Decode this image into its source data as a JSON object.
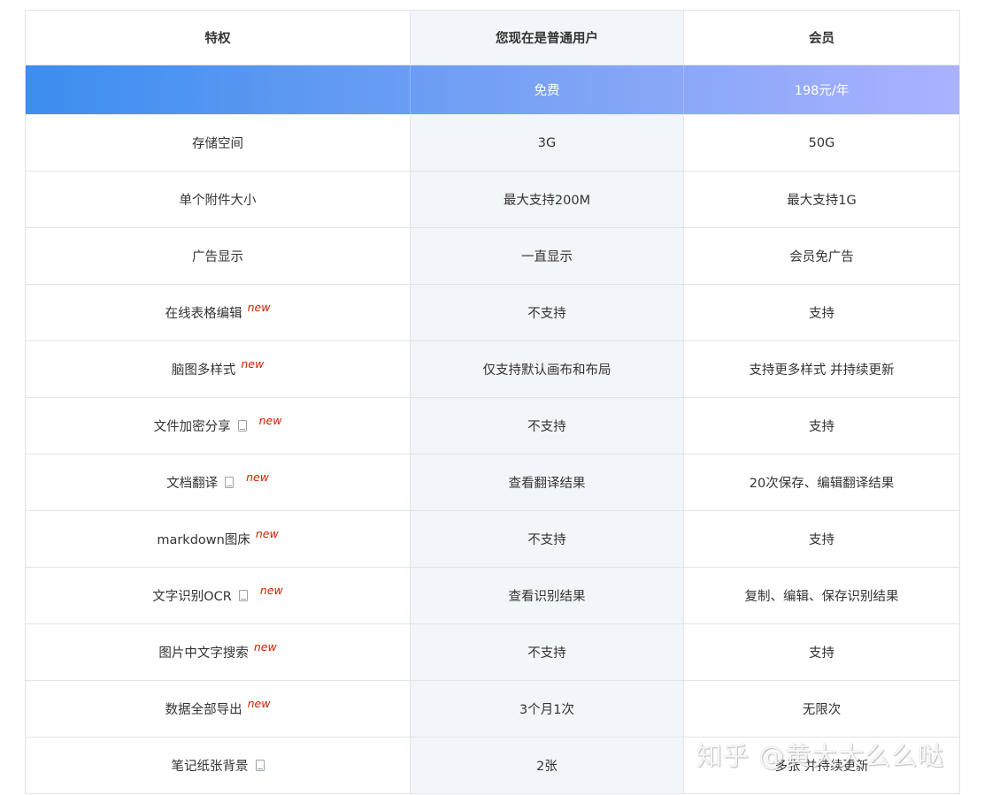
{
  "header": {
    "col1": "特权",
    "col2": "您现在是普通用户",
    "col3": "会员"
  },
  "price": {
    "col1": "",
    "col2": "免费",
    "col3": "198元/年"
  },
  "rows": [
    {
      "feature": "存储空间",
      "device": false,
      "new": "",
      "free": "3G",
      "member": "50G"
    },
    {
      "feature": "单个附件大小",
      "device": false,
      "new": "",
      "free": "最大支持200M",
      "member": "最大支持1G"
    },
    {
      "feature": "广告显示",
      "device": false,
      "new": "",
      "free": "一直显示",
      "member": "会员免广告"
    },
    {
      "feature": "在线表格编辑",
      "device": false,
      "new": "new",
      "free": "不支持",
      "member": "支持"
    },
    {
      "feature": "脑图多样式",
      "device": false,
      "new": "new",
      "free": "仅支持默认画布和布局",
      "member": "支持更多样式 并持续更新"
    },
    {
      "feature": "文件加密分享",
      "device": true,
      "new": "new",
      "free": "不支持",
      "member": "支持"
    },
    {
      "feature": "文档翻译",
      "device": true,
      "new": "new",
      "free": "查看翻译结果",
      "member": "20次保存、编辑翻译结果"
    },
    {
      "feature": "markdown图床",
      "device": false,
      "new": "new",
      "free": "不支持",
      "member": "支持"
    },
    {
      "feature": "文字识别OCR",
      "device": true,
      "new": "new",
      "free": "查看识别结果",
      "member": "复制、编辑、保存识别结果"
    },
    {
      "feature": "图片中文字搜索",
      "device": false,
      "new": "new",
      "free": "不支持",
      "member": "支持"
    },
    {
      "feature": "数据全部导出",
      "device": false,
      "new": "new",
      "free": "3个月1次",
      "member": "无限次"
    },
    {
      "feature": "笔记纸张背景",
      "device": true,
      "new": "",
      "free": "2张",
      "member": "多张 并持续更新"
    }
  ],
  "watermark": "知乎 @黄大大么么哒",
  "colors": {
    "gradient_start": "#3c8ef0",
    "gradient_end": "#aab2ff",
    "new_tag": "#cc2200",
    "free_column_bg": "#f2f6fa"
  }
}
